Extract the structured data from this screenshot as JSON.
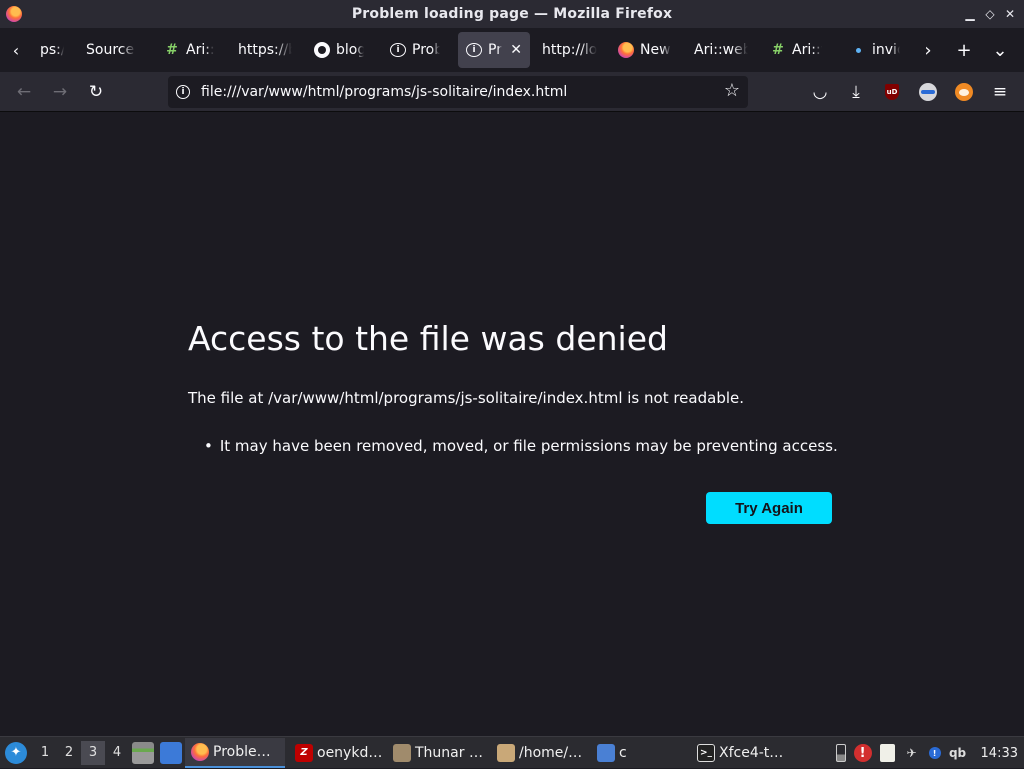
{
  "window": {
    "title": "Problem loading page — Mozilla Firefox",
    "controls": {
      "minimize": "▁",
      "maximize": "◇",
      "close": "✕"
    }
  },
  "tabs": [
    {
      "label": "ps://b",
      "icon": "none",
      "active": false
    },
    {
      "label": "Source |",
      "icon": "none",
      "active": false
    },
    {
      "label": "Ari::v",
      "icon": "hash-icon",
      "active": false
    },
    {
      "label": "https://b",
      "icon": "none",
      "active": false
    },
    {
      "label": "blog",
      "icon": "github-icon",
      "active": false
    },
    {
      "label": "Probl",
      "icon": "info-icon",
      "active": false
    },
    {
      "label": "Pro",
      "icon": "info-icon",
      "active": true,
      "close": "✕"
    },
    {
      "label": "http://lo",
      "icon": "none",
      "active": false
    },
    {
      "label": "New",
      "icon": "firefox-icon",
      "active": false
    },
    {
      "label": "Ari::web",
      "icon": "none",
      "active": false
    },
    {
      "label": "Ari::v",
      "icon": "hash-icon",
      "active": false
    },
    {
      "label": "invid",
      "icon": "dot-icon",
      "active": false
    }
  ],
  "tabstrip": {
    "scroll_left": "‹",
    "scroll_right": "›",
    "new_tab": "+",
    "list_all": "⌄"
  },
  "nav": {
    "back": "←",
    "forward": "→",
    "reload": "↻",
    "url": "file:///var/www/html/programs/js-solitaire/index.html",
    "info": "i",
    "bookmark_star": "☆",
    "pocket": "◡",
    "download": "⤓",
    "ublock_label": "uD",
    "menu": "≡"
  },
  "error": {
    "title": "Access to the file was denied",
    "description": "The file at /var/www/html/programs/js-solitaire/index.html is not readable.",
    "bullet": "•",
    "reason": "It may have been removed, moved, or file permissions may be preventing access.",
    "button": "Try Again"
  },
  "taskbar": {
    "workspaces": [
      "1",
      "2",
      "3",
      "4"
    ],
    "active_workspace": "3",
    "tasks": [
      {
        "label": "Proble…",
        "icon": "firefox-icon",
        "active": true
      },
      {
        "label": "oenykd…",
        "icon": "filezilla-icon",
        "glyph": "Z",
        "active": false
      },
      {
        "label": "Thunar …",
        "icon": "thunar-icon",
        "active": false
      },
      {
        "label": "/home/…",
        "icon": "archive-icon",
        "active": false
      },
      {
        "label": "c",
        "icon": "folder-icon",
        "active": false
      },
      {
        "label": "Xfce4-t…",
        "icon": "terminal-icon",
        "glyph": ">_",
        "active": false
      }
    ],
    "tray": {
      "alert": "!",
      "update": "!",
      "qb": "qb"
    },
    "clock": "14:33"
  },
  "colors": {
    "accent": "#00ddff",
    "background": "#1c1b22",
    "toolbar": "#2b2a33"
  }
}
